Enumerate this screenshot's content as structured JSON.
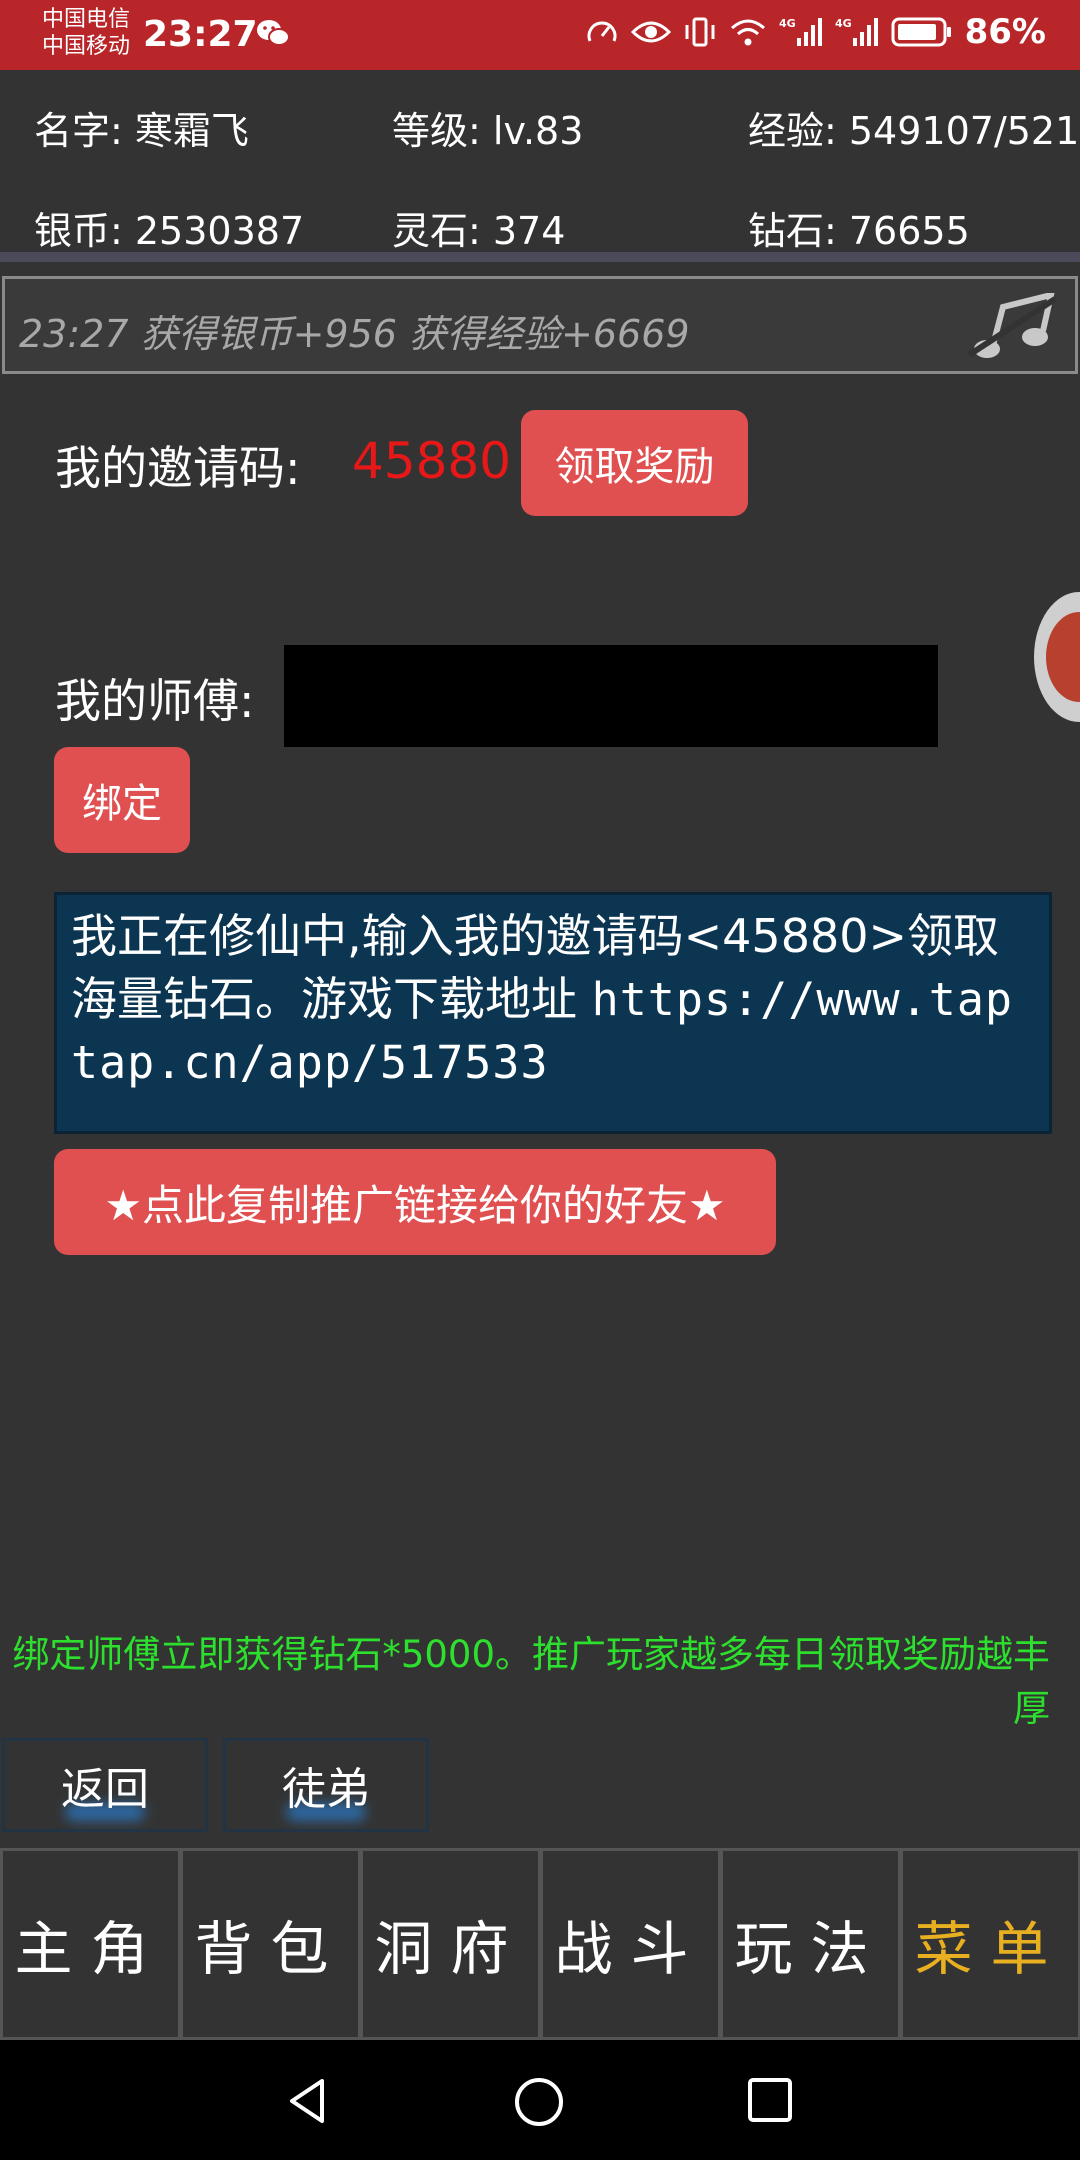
{
  "status_bar": {
    "carrier_1": "中国电信",
    "carrier_2": "中国移动",
    "time": "23:27",
    "battery": "86%",
    "icons": [
      "wechat-icon",
      "speed-icon",
      "eye-icon",
      "vibrate-icon",
      "wifi-icon",
      "signal-4g-icon",
      "signal-4g-icon",
      "battery-icon"
    ]
  },
  "player": {
    "name": "名字: 寒霜飞",
    "level": "等级: lv.83",
    "exp": "经验: 549107/521",
    "silver": "银币: 2530387",
    "spirit_stone": "灵石: 374",
    "diamond": "钻石: 76655"
  },
  "message": {
    "text": "23:27 获得银币+956 获得经验+6669",
    "icon": "music-note-icon"
  },
  "invite": {
    "label": "我的邀请码:",
    "code": "45880",
    "claim_button": "领取奖励"
  },
  "master": {
    "label": "我的师傅:",
    "bind_button": "绑定"
  },
  "share": {
    "text": "我正在修仙中,输入我的邀请码<45880>领取海量钻石。游戏下载地址",
    "url": "https://www.taptap.cn/app/517533",
    "copy_button": "★点此复制推广链接给你的好友★"
  },
  "tip": "绑定师傅立即获得钻石*5000。推广玩家越多每日领取奖励越丰厚",
  "sub_buttons": {
    "back": "返回",
    "disciple": "徒弟"
  },
  "nav": [
    {
      "label": "主角",
      "active": false
    },
    {
      "label": "背包",
      "active": false
    },
    {
      "label": "洞府",
      "active": false
    },
    {
      "label": "战斗",
      "active": false
    },
    {
      "label": "玩法",
      "active": false
    },
    {
      "label": "菜单",
      "active": true
    }
  ],
  "colors": {
    "status_bar": "#b8262a",
    "background": "#333333",
    "button_red": "#e05050",
    "invite_code": "#e81818",
    "tip_green": "#2ee02e",
    "menu_active": "#e8b020",
    "share_box": "#0b3550"
  }
}
